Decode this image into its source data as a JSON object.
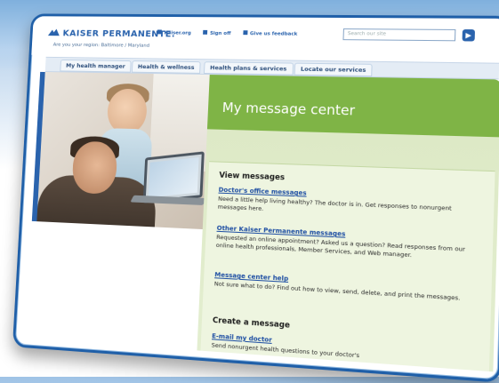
{
  "header": {
    "logo_text": "KAISER PERMANENTE.",
    "sub_link": "Are you your region: Baltimore / Maryland",
    "top_links": [
      "Kaiser.org",
      "Sign off",
      "Give us feedback"
    ],
    "search_placeholder": "Search our site",
    "go_label": "Go"
  },
  "nav": {
    "tabs": [
      "My health manager",
      "Health & wellness",
      "Health plans & services",
      "Locate our services"
    ]
  },
  "message_center": {
    "title": "My message center",
    "view_heading": "View messages",
    "items": [
      {
        "link": "Doctor's office messages",
        "desc": "Need a little help living healthy? The doctor is in. Get responses to nonurgent messages here."
      },
      {
        "link": "Other Kaiser Permanente messages",
        "desc": "Requested an online appointment? Asked us a question? Read responses from our online health professionals, Member Services, and Web manager."
      },
      {
        "link": "Message center help",
        "desc": "Not sure what to do? Find out how to view, send, delete, and print the messages."
      }
    ],
    "create_heading": "Create a message",
    "create_link": "E-mail my doctor",
    "create_desc": "Send nonurgent health questions to your doctor's"
  },
  "colors": {
    "brand_blue": "#2a63ad",
    "green_header": "#7fb446",
    "panel_green": "#eef5e0",
    "link_blue": "#1f4fa3"
  }
}
